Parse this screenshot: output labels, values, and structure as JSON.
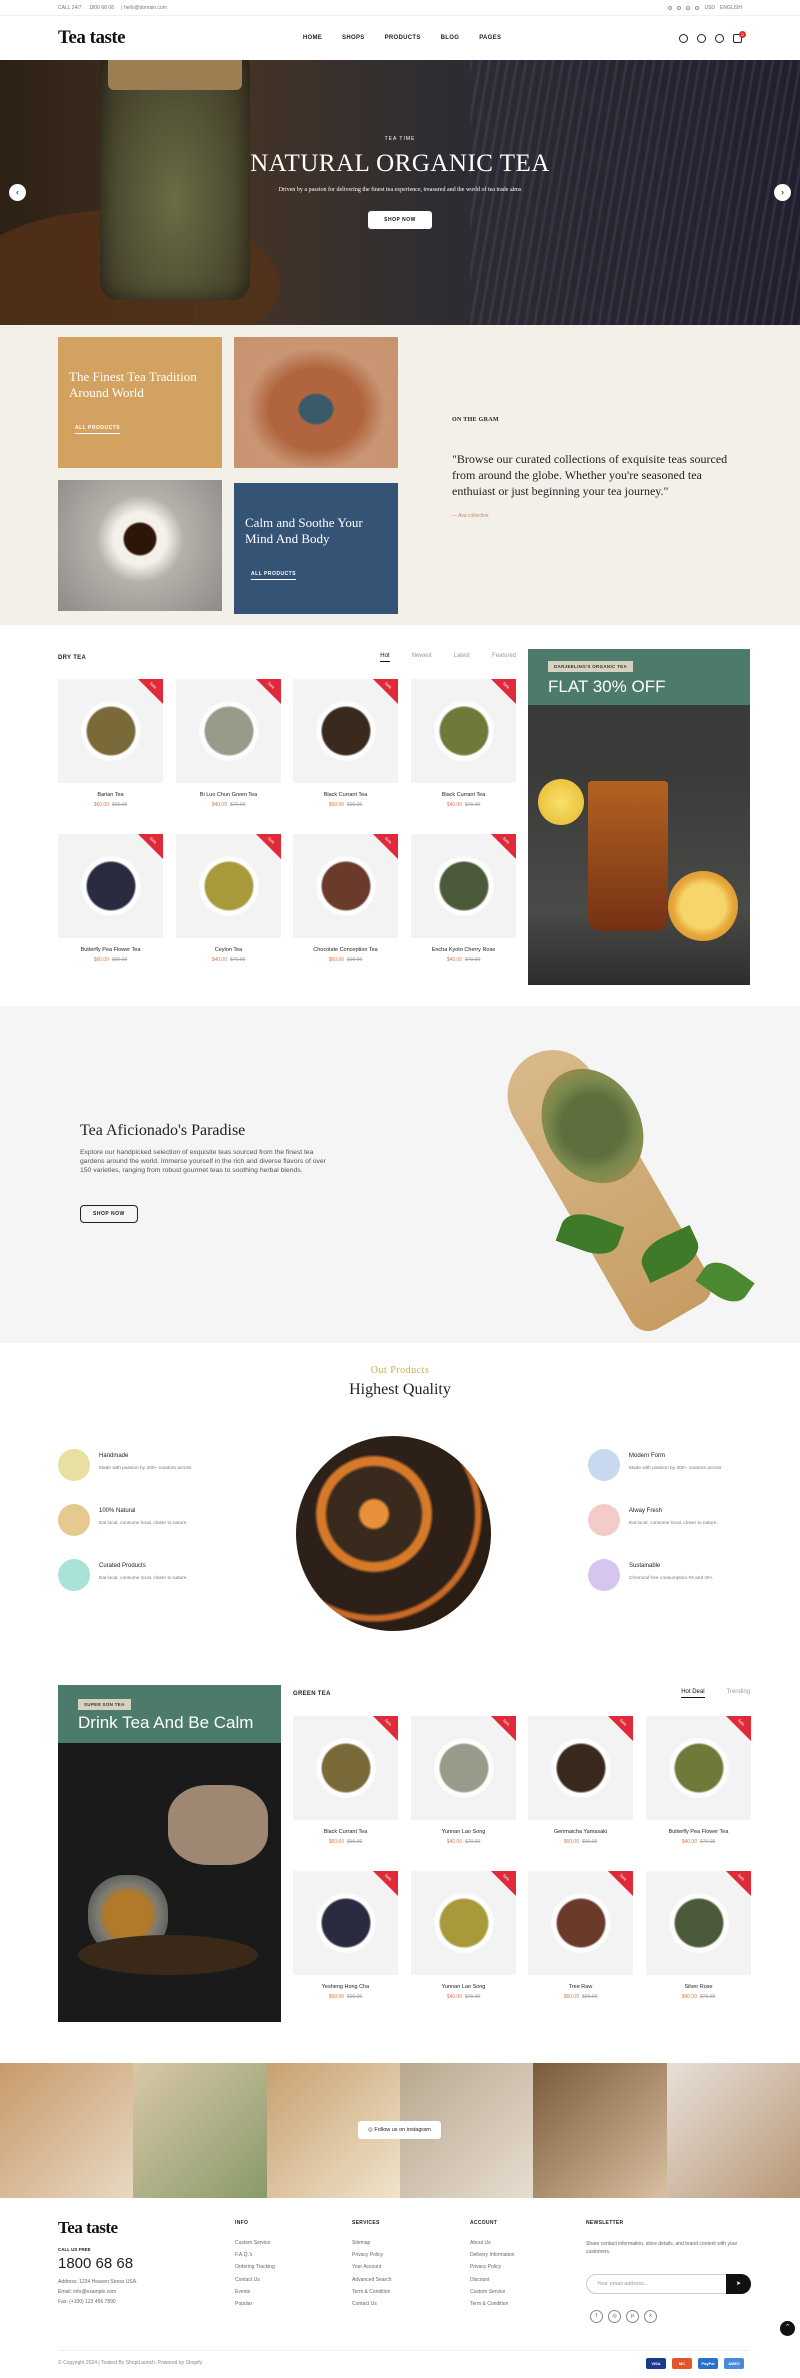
{
  "topbar": {
    "call_label": "CALL 24/7:",
    "phone": "1800 68 68",
    "email": "hello@domain.com",
    "currency": "USD",
    "language": "ENGLISH"
  },
  "header": {
    "logo": "Tea taste",
    "nav": [
      "HOME",
      "SHOPS",
      "PRODUCTS",
      "BLOG",
      "PAGES"
    ],
    "cart_count": "0"
  },
  "hero": {
    "kicker": "TEA TIME",
    "title": "NATURAL ORGANIC TEA",
    "text": "Driven by a passion for delivering the finest tea experience, treasured and the world of tea trade aims",
    "button": "SHOP NOW",
    "prev": "‹",
    "next": "›"
  },
  "collections": {
    "tile1_title": "The Finest Tea Tradition Around World",
    "tile1_link": "ALL PRODUCTS",
    "tile2_title": "Calm and Soothe Your Mind And Body",
    "tile2_link": "ALL PRODUCTS",
    "gram_heading": "ON THE GRAM",
    "quote": "\"Browse our curated collections of exquisite teas sourced from around the globe. Whether you're seasoned tea enthuiast or just beginning your tea journey.\"",
    "author": "— Ava collective"
  },
  "dry_tea": {
    "title": "DRY TEA",
    "tabs": [
      "Hot",
      "Newest",
      "Latest",
      "Featured"
    ],
    "products": [
      {
        "name": "Barian Tea",
        "price": "$60.00",
        "old": "$90.00",
        "badge": "Sale"
      },
      {
        "name": "Bi Luo Chun Green Tea",
        "price": "$40.00",
        "old": "$70.00",
        "badge": "Sale"
      },
      {
        "name": "Black Currant Tea",
        "price": "$60.00",
        "old": "$90.00",
        "badge": "Sale"
      },
      {
        "name": "Black Currant Tea",
        "price": "$40.00",
        "old": "$70.00",
        "badge": "Sale"
      },
      {
        "name": "Butterfly Pea Flower Tea",
        "price": "$60.00",
        "old": "$90.00",
        "badge": "Sale"
      },
      {
        "name": "Ceylon Tea",
        "price": "$40.00",
        "old": "$70.00",
        "badge": "Sale"
      },
      {
        "name": "Chocolate Conception Tea",
        "price": "$60.00",
        "old": "$90.00",
        "badge": "Sale"
      },
      {
        "name": "Encha Kyoto Cherry Rose",
        "price": "$40.00",
        "old": "$70.00",
        "badge": "Sale"
      }
    ],
    "banner_tag": "DARJEELING'S ORGANIC TEA",
    "banner_title": "FLAT 30% OFF"
  },
  "aficionado": {
    "title": "Tea Aficionado's Paradise",
    "text": "Explore our handpicked selection of exquisite teas sourced from the finest tea gardens around the world. Immerse yourself in the rich and diverse flavors of over 150 varieties, ranging from robust gourmet teas to soothing herbal blends.",
    "button": "SHOP NOW"
  },
  "quality": {
    "kicker": "Out Products",
    "title": "Highest Quality",
    "features_left": [
      {
        "title": "Handmade",
        "text": "Made with passion by 200+ curators across",
        "color": "#e8dfa2"
      },
      {
        "title": "100% Natural",
        "text": "Eat local, consume local, closer to nature.",
        "color": "#e6c98e"
      },
      {
        "title": "Curated Products",
        "text": "Eat local, consume local, closer to nature.",
        "color": "#a9e3d8"
      }
    ],
    "features_right": [
      {
        "title": "Modern Form",
        "text": "Made with passion by 200+ curators across",
        "color": "#c7d8ef"
      },
      {
        "title": "Alway Fresh",
        "text": "Eat local, consume local, closer to nature.",
        "color": "#f3ccc8"
      },
      {
        "title": "Sustainable",
        "text": "Chemical free consumption #4 and OH.",
        "color": "#d5c6ef"
      }
    ]
  },
  "green_tea": {
    "banner_tag": "SUPER SON TEA",
    "banner_title": "Drink Tea And Be Calm",
    "title": "GREEN TEA",
    "tabs": [
      "Hot Deal",
      "Trending"
    ],
    "products": [
      {
        "name": "Black Currant Tea",
        "price": "$60.00",
        "old": "$90.00",
        "badge": "Sale"
      },
      {
        "name": "Yunnan Lao Song",
        "price": "$40.00",
        "old": "$70.00",
        "badge": "Sale"
      },
      {
        "name": "Genmaicha Yamasaki",
        "price": "$60.00",
        "old": "$90.00",
        "badge": "Sale"
      },
      {
        "name": "Butterfly Pea Flower Tea",
        "price": "$40.00",
        "old": "$70.00",
        "badge": "Sale"
      },
      {
        "name": "Yesheng Hong Cha",
        "price": "$60.00",
        "old": "$90.00",
        "badge": "Sale"
      },
      {
        "name": "Yunnan Lao Song",
        "price": "$40.00",
        "old": "$70.00",
        "badge": "Sale"
      },
      {
        "name": "Tree Raw",
        "price": "$60.00",
        "old": "$90.00",
        "badge": "Sale"
      },
      {
        "name": "Silver Rose",
        "price": "$40.00",
        "old": "$70.00",
        "badge": "Sale"
      }
    ]
  },
  "instagram": {
    "label": "Follow us on instagram"
  },
  "footer": {
    "logo": "Tea taste",
    "tollfree_label": "CALL US FREE",
    "phone": "1800 68 68",
    "address": "Address: 1234 Heaven Stress USA.",
    "email": "Email: info@example.com",
    "fax": "Fax: (+100) 123 456 7890",
    "info_title": "INFO",
    "info_links": [
      "Custom Service",
      "F.A.Q.'s",
      "Ordering Tracking",
      "Contact Us",
      "Events",
      "Popular"
    ],
    "services_title": "SERVICES",
    "services_links": [
      "Sitemap",
      "Privacy Policy",
      "Your Account",
      "Advanced Search",
      "Term & Condition",
      "Contact Us"
    ],
    "account_title": "ACCOUNT",
    "account_links": [
      "About Us",
      "Delivery Information",
      "Privacy Policy",
      "Discount",
      "Custom Service",
      "Term & Condition"
    ],
    "news_title": "NEWSLETTER",
    "news_text": "Share contact information, store details, and brand content with your customers.",
    "email_placeholder": "Your email address...",
    "copyright": "© Copyright 2024 | Teatest By ShopiLaunch. Powered by Shopify.",
    "payments": [
      "VISA",
      "MC",
      "PayPal",
      "AMEX"
    ]
  }
}
